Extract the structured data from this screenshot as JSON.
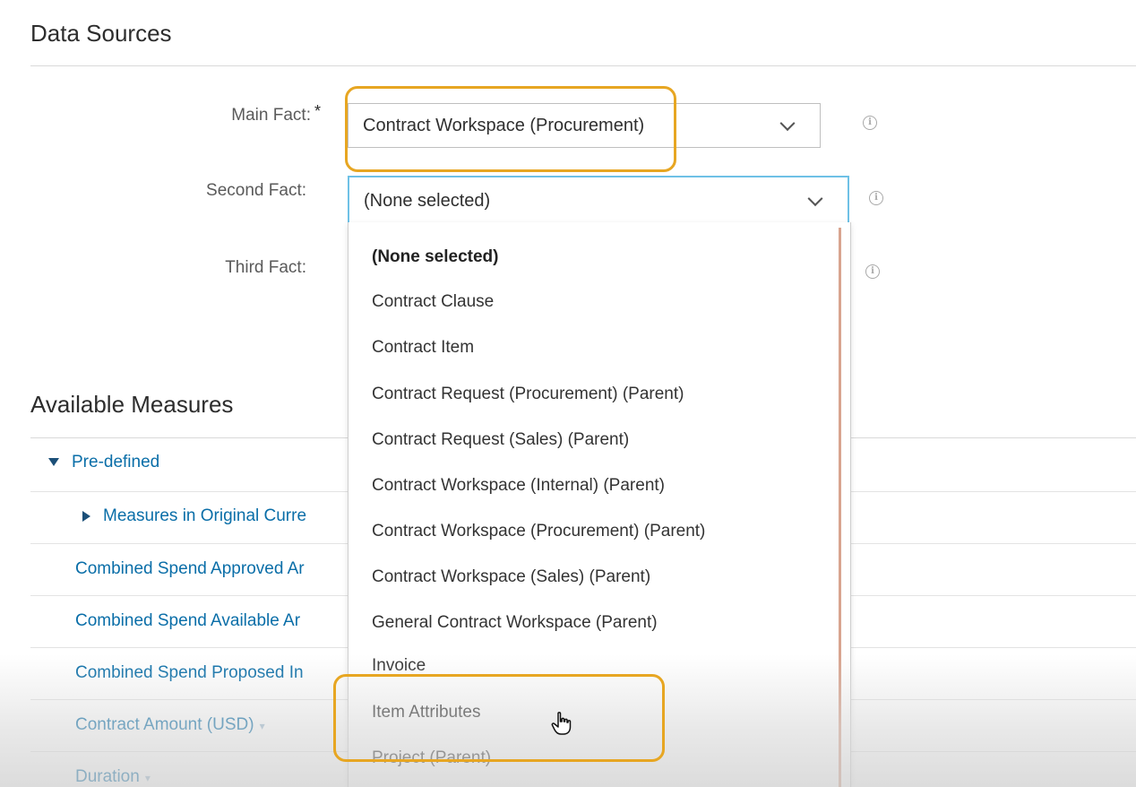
{
  "data_sources": {
    "title": "Data Sources",
    "main_fact": {
      "label": "Main Fact:",
      "required_mark": "*",
      "value": "Contract Workspace (Procurement)"
    },
    "second_fact": {
      "label": "Second Fact:",
      "value": "(None selected)"
    },
    "third_fact": {
      "label": "Third Fact:"
    }
  },
  "dropdown": {
    "options": [
      "(None selected)",
      "Contract Clause",
      "Contract Item",
      "Contract Request (Procurement) (Parent)",
      "Contract Request (Sales) (Parent)",
      "Contract Workspace (Internal) (Parent)",
      "Contract Workspace (Procurement) (Parent)",
      "Contract Workspace (Sales) (Parent)",
      "General Contract Workspace (Parent)",
      "Invoice",
      "Item Attributes",
      "Project (Parent)"
    ],
    "selected": "(None selected)",
    "hovered": "Item Attributes"
  },
  "measures": {
    "title": "Available Measures",
    "predefined_label": "Pre-defined",
    "original_currency_label": "Measures in Original Curre",
    "items": [
      "Combined Spend Approved Ar",
      "Combined Spend Available Ar",
      "Combined Spend Proposed In",
      "Contract Amount (USD)",
      "Duration"
    ]
  },
  "colors": {
    "highlight": "#e7a622",
    "link": "#0a6ea8",
    "focus_border": "#6ec1e6"
  }
}
